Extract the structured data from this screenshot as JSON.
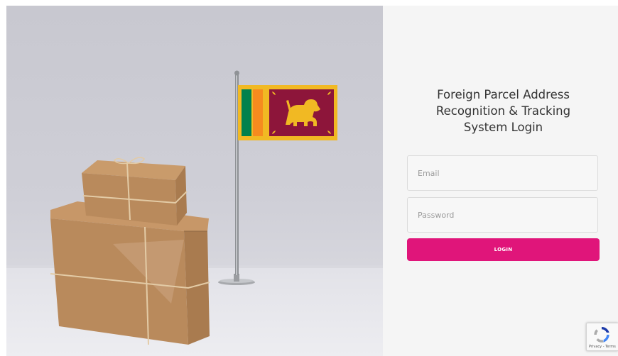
{
  "login": {
    "title": "Foreign Parcel Address\nRecognition & Tracking\nSystem Login",
    "email_placeholder": "Email",
    "password_placeholder": "Password",
    "login_label": "LOGIN"
  },
  "recaptcha": {
    "legal": "Privacy - Terms"
  },
  "colors": {
    "accent": "#e0157a",
    "panel_bg": "#f5f5f5",
    "flag_yellow": "#f1b923",
    "flag_maroon": "#8d153a",
    "flag_green": "#00814d",
    "flag_orange": "#f68b1f"
  },
  "icons": {
    "recaptcha": "recaptcha-icon",
    "flag": "sri-lanka-flag",
    "parcels": "parcel-boxes"
  }
}
